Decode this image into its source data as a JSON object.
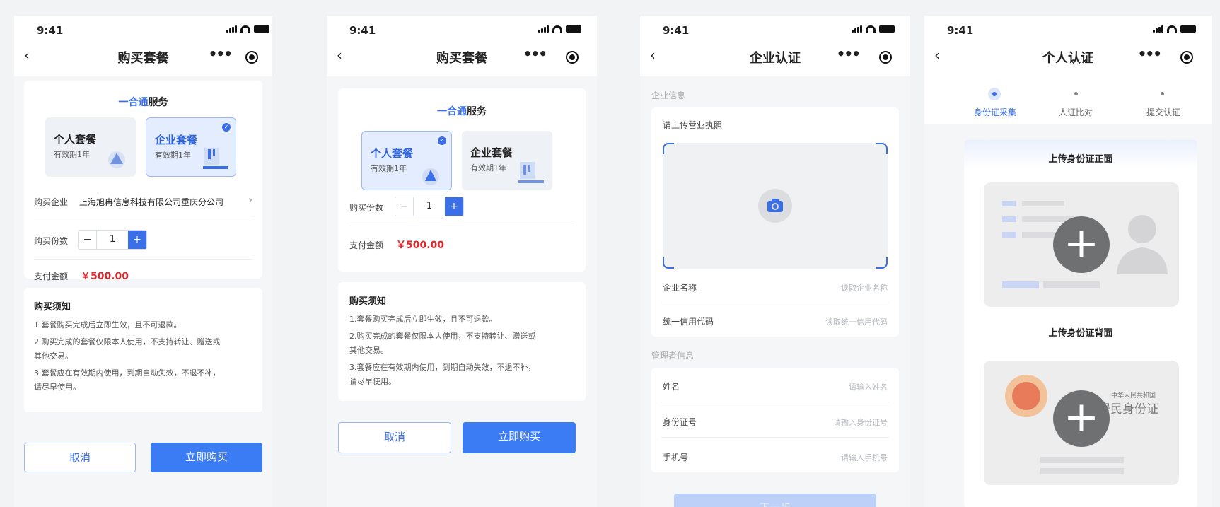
{
  "status": {
    "time": "9:41"
  },
  "screen1": {
    "title": "购买套餐",
    "brand_pre": "一合通",
    "brand_post": "服务",
    "pkg_personal": {
      "name": "个人套餐",
      "validity": "有效期1年"
    },
    "pkg_enterprise": {
      "name": "企业套餐",
      "validity": "有效期1年"
    },
    "company_label": "购买企业",
    "company_value": "上海旭冉信息科技有限公司重庆分公司",
    "qty_label": "购买份数",
    "qty": "1",
    "minus": "−",
    "plus": "+",
    "pay_label": "支付金额",
    "pay_value": "￥500.00",
    "notice_title": "购买须知",
    "notice": [
      "1.套餐购买完成后立即生效，且不可退款。",
      "2.购买完成的套餐仅限本人使用，不支持转让、赠送或",
      "其他交易。",
      "3.套餐应在有效期内使用，到期自动失效，不退不补，",
      "请尽早使用。"
    ],
    "cancel": "取消",
    "buy": "立即购买"
  },
  "screen2": {
    "title": "购买套餐",
    "brand_pre": "一合通",
    "brand_post": "服务",
    "pkg_personal": {
      "name": "个人套餐",
      "validity": "有效期1年"
    },
    "pkg_enterprise": {
      "name": "企业套餐",
      "validity": "有效期1年"
    },
    "qty_label": "购买份数",
    "qty": "1",
    "minus": "−",
    "plus": "+",
    "pay_label": "支付金额",
    "pay_value": "￥500.00",
    "notice_title": "购买须知",
    "notice": [
      "1.套餐购买完成后立即生效，且不可退款。",
      "2.购买完成的套餐仅限本人使用，不支持转让、赠送或",
      "其他交易。",
      "3.套餐应在有效期内使用，到期自动失效，不退不补，",
      "请尽早使用。"
    ],
    "cancel": "取消",
    "buy": "立即购买"
  },
  "screen3": {
    "title": "企业认证",
    "sec_company": "企业信息",
    "upload_label": "请上传营业执照",
    "fields1": [
      {
        "label": "企业名称",
        "placeholder": "读取企业名称"
      },
      {
        "label": "统一信用代码",
        "placeholder": "读取统一信用代码"
      }
    ],
    "sec_admin": "管理者信息",
    "fields2": [
      {
        "label": "姓名",
        "placeholder": "请输入姓名"
      },
      {
        "label": "身份证号",
        "placeholder": "请输入身份证号"
      },
      {
        "label": "手机号",
        "placeholder": "请输入手机号"
      }
    ],
    "next": "下一步"
  },
  "screen4": {
    "title": "个人认证",
    "steps": [
      "身份证采集",
      "人证比对",
      "提交认证"
    ],
    "front_title": "上传身份证正面",
    "back_title": "上传身份证背面",
    "card_country": "中华人民共和国",
    "card_name": "居民身份证"
  },
  "colors": {
    "accent": "#3b7bf3",
    "price": "#e0262b"
  }
}
